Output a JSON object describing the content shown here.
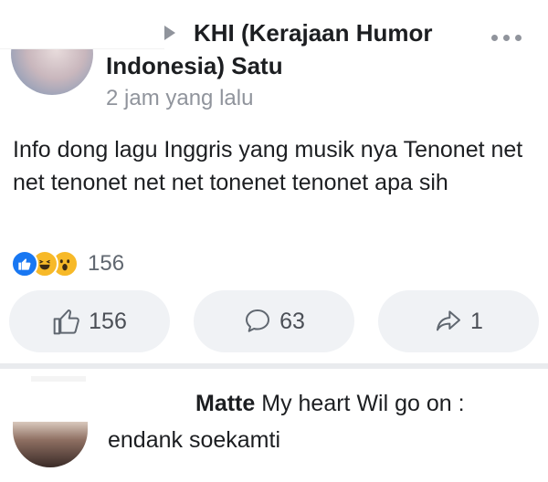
{
  "post": {
    "group_name": "KHI (Kerajaan Humor Indonesia) Satu",
    "timestamp": "2 jam yang lalu",
    "text": "Info dong lagu Inggris yang musik nya Tenonet net net tenonet net net tonenet tenonet apa sih",
    "reactions": {
      "icons": [
        "like-icon",
        "haha-icon",
        "wow-icon"
      ],
      "count": "156"
    },
    "actions": {
      "like_count": "156",
      "comment_count": "63",
      "share_count": "1"
    }
  },
  "comment": {
    "author": "Matte",
    "text_line1": "My heart Wil go on :",
    "text_line2": "endank soekamti"
  },
  "colors": {
    "like_blue": "#1877f2",
    "reaction_yellow": "#f7b928",
    "muted_text": "#90949c",
    "button_bg": "#f0f2f5"
  }
}
